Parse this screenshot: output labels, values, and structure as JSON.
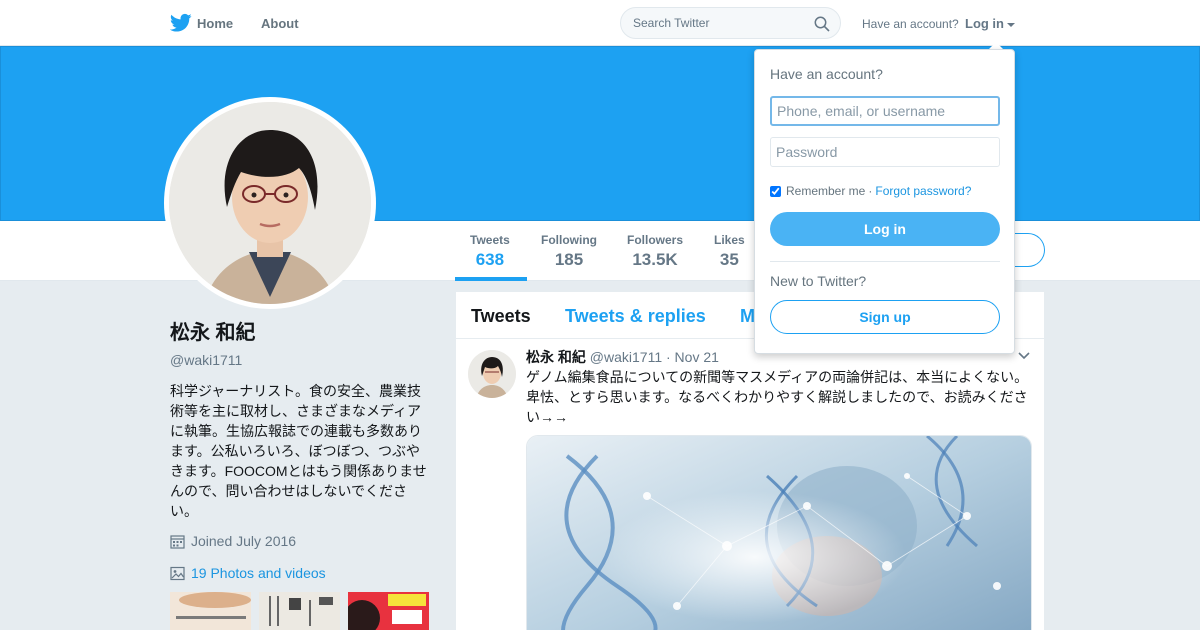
{
  "nav": {
    "home_label": "Home",
    "about_label": "About",
    "search_placeholder": "Search Twitter",
    "have_account": "Have an account?",
    "login_label": "Log in"
  },
  "profile": {
    "name": "松永 和紀",
    "handle": "@waki1711",
    "bio": "科学ジャーナリスト。食の安全、農業技術等を主に取材し、さまざまなメディアに執筆。生協広報誌での連載も多数あります。公私いろいろ、ぼつぼつ、つぶやきます。FOOCOMとはもう関係ありませんので、問い合わせはしないでください。",
    "joined": "Joined July 2016",
    "photos_link": "19 Photos and videos"
  },
  "stats": [
    {
      "label": "Tweets",
      "value": "638"
    },
    {
      "label": "Following",
      "value": "185"
    },
    {
      "label": "Followers",
      "value": "13.5K"
    },
    {
      "label": "Likes",
      "value": "35"
    }
  ],
  "timeline": {
    "tabs": [
      "Tweets",
      "Tweets & replies",
      "M"
    ],
    "tweet": {
      "name": "松永 和紀",
      "handle": "@waki1711",
      "date": "· Nov 21",
      "text": "ゲノム編集食品についての新聞等マスメディアの両論併記は、本当によくない。卑怯、とすら思います。なるべくわかりやすく解説しましたので、お読みください→→"
    }
  },
  "login_dropdown": {
    "title": "Have an account?",
    "username_placeholder": "Phone, email, or username",
    "password_placeholder": "Password",
    "remember_label": "Remember me",
    "separator": "·",
    "forgot_label": "Forgot password?",
    "login_button": "Log in",
    "new_prompt": "New to Twitter?",
    "signup_button": "Sign up"
  },
  "colors": {
    "brand": "#1da1f2",
    "link": "#1b95e0",
    "background": "#e6ecf0"
  }
}
